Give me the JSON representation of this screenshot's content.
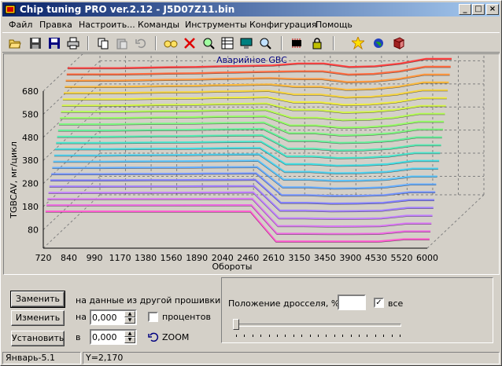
{
  "window": {
    "title": "Chip tuning PRO ver.2.12  -  J5D07Z11.bin"
  },
  "menu": {
    "items": [
      "Файл",
      "Правка",
      "Настроить...",
      "Команды",
      "Инструменты",
      "Конфигурация",
      "Помощь"
    ]
  },
  "toolbar": {
    "icons": [
      "open-folder-icon",
      "save-icon",
      "save-as-icon",
      "print-icon",
      "copy-icon",
      "paste-icon",
      "undo-icon",
      "glasses-icon",
      "delete-x-icon",
      "zoom-ok-icon",
      "table-icon",
      "monitor-icon",
      "zoom-in-icon",
      "chip-icon",
      "lock-icon",
      "burst-icon",
      "globe-icon",
      "book-icon"
    ]
  },
  "chart_data": {
    "type": "line",
    "title": "Аварийное GBC",
    "xlabel": "Обороты",
    "ylabel": "TGBCAV, мг/цикл",
    "x_ticks": [
      "720",
      "840",
      "990",
      "1170",
      "1380",
      "1560",
      "1890",
      "2040",
      "2460",
      "2610",
      "3150",
      "3450",
      "3900",
      "4530",
      "5520",
      "6000"
    ],
    "y_ticks": [
      "80",
      "180",
      "280",
      "380",
      "480",
      "580",
      "680"
    ],
    "ylim": [
      0,
      680
    ],
    "series_count": 24,
    "top_surface_front_row": [
      680,
      680,
      680,
      682,
      684,
      685,
      688,
      690,
      692,
      700,
      700,
      685,
      688,
      700,
      720,
      720
    ],
    "bottom_surface_front_row": [
      150,
      150,
      150,
      150,
      150,
      150,
      150,
      150,
      150,
      20,
      20,
      20,
      20,
      20,
      30,
      30
    ],
    "color_ramp": [
      "#ff5ad0",
      "#d080ff",
      "#8080ff",
      "#60c0ff",
      "#40e0e0",
      "#60f0a0",
      "#a0ff60",
      "#f0f040",
      "#ffb040",
      "#ff4040"
    ]
  },
  "controls": {
    "replace_label": "Заменить",
    "change_label": "Изменить",
    "set_label": "Установить",
    "other_firmware_label": "на данные из другой прошивки",
    "by_label": "на",
    "in_label": "в",
    "by_value": "0,000",
    "in_value": "0,000",
    "percent_label": "процентов",
    "zoom_label": "ZOOM"
  },
  "throttle": {
    "label": "Положение дросселя, %",
    "value": "",
    "all_label": "все",
    "all_checked": true,
    "slider_fraction": 0
  },
  "status": {
    "left": "Январь-5.1",
    "right": "Y=2,170"
  }
}
